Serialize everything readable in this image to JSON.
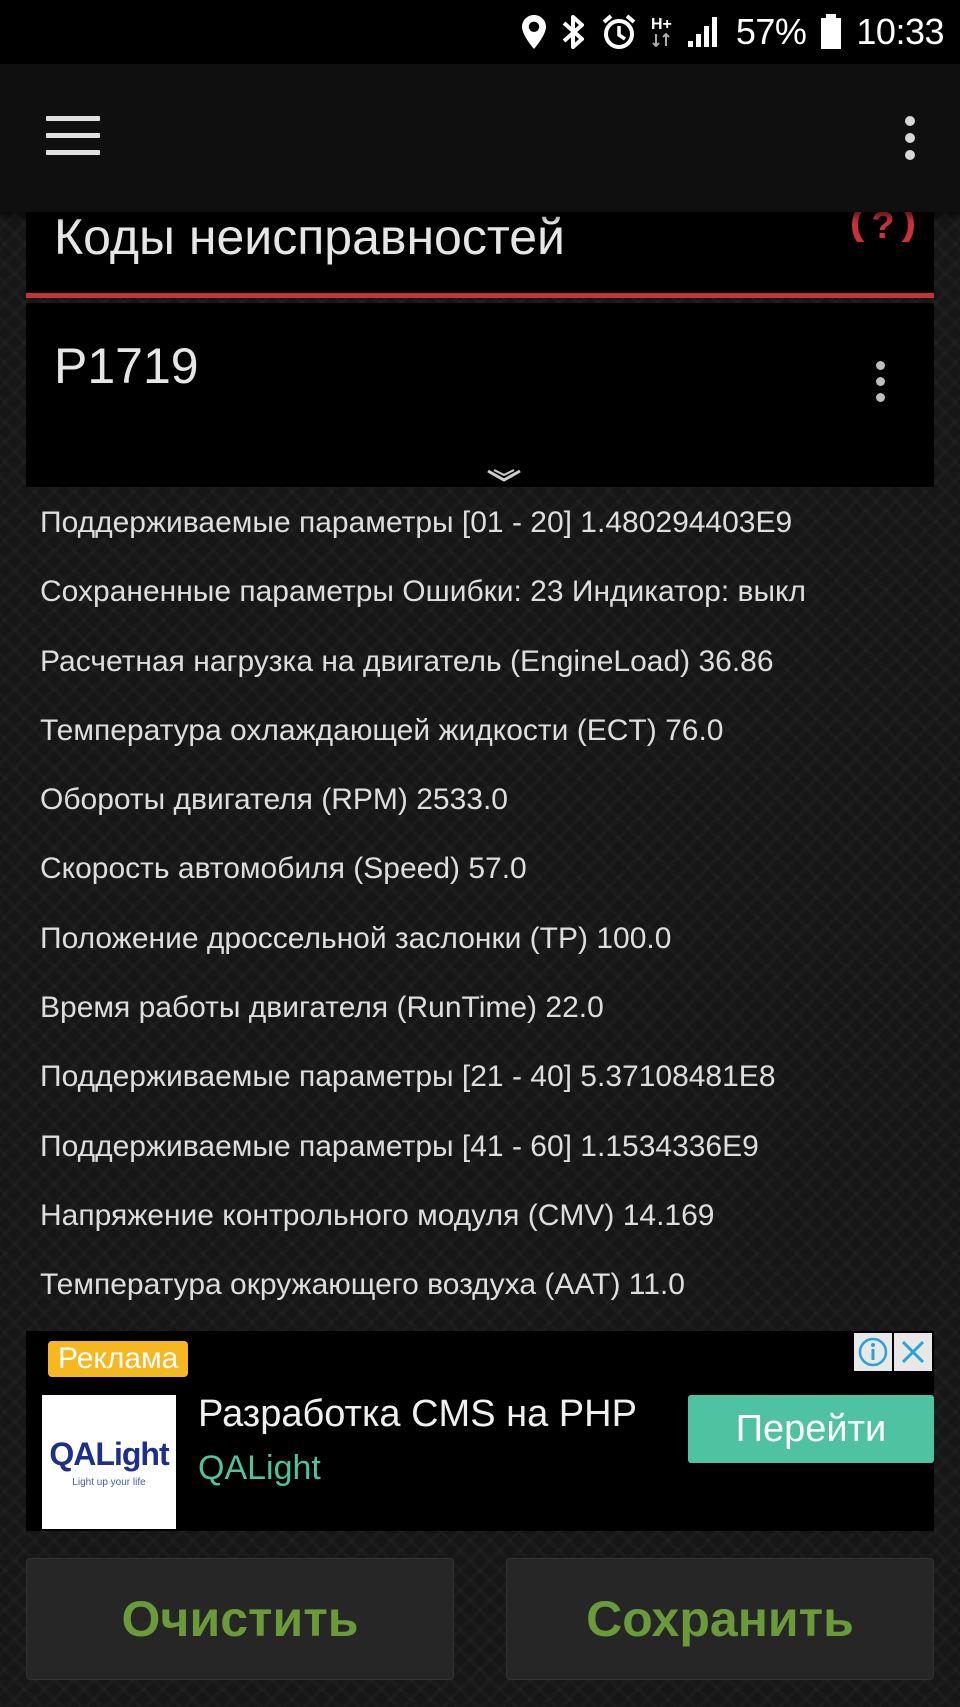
{
  "status_bar": {
    "battery": "57%",
    "time": "10:33",
    "network": "H+"
  },
  "header": {
    "title": "Коды неисправностей"
  },
  "code": {
    "title": "P1719"
  },
  "params": [
    "Поддерживаемые параметры [01 - 20] 1.480294403E9",
    "Сохраненные параметры Ошибки: 23 Индикатор: выкл",
    "Расчетная нагрузка на двигатель (EngineLoad) 36.86",
    "Температура охлаждающей жидкости (ECT) 76.0",
    "Обороты двигателя (RPM) 2533.0",
    "Скорость автомобиля (Speed) 57.0",
    "Положение дроссельной заслонки (TP) 100.0",
    "Время работы двигателя (RunTime) 22.0",
    "Поддерживаемые параметры [21 - 40] 5.37108481E8",
    "Поддерживаемые параметры [41 - 60] 1.1534336E9",
    "Напряжение контрольного модуля (CMV) 14.169",
    "Температура окружающего воздуха (AAT) 11.0"
  ],
  "ad": {
    "badge": "Реклама",
    "logo_text": "QALight",
    "logo_tagline": "Light up your life",
    "title": "Разработка CMS на PHP",
    "brand": "QALight",
    "cta": "Перейти"
  },
  "buttons": {
    "clear": "Очистить",
    "save": "Сохранить"
  },
  "colors": {
    "accent_red": "#c8323a",
    "button_text_green": "#6a9a3a",
    "ad_green": "#4fc3a1",
    "ad_badge": "#f5b820"
  }
}
